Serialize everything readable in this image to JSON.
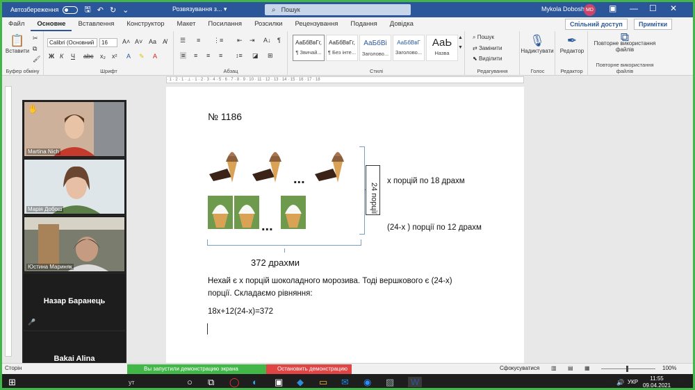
{
  "titlebar": {
    "autosave_label": "Автозбереження",
    "document_title": "Розвязування з... ▾",
    "search_placeholder": "Пошук",
    "user_name": "Mykola Dobosh",
    "user_initials": "MD"
  },
  "tabs": [
    "Файл",
    "Основне",
    "Вставлення",
    "Конструктор",
    "Макет",
    "Посилання",
    "Розсилки",
    "Рецензування",
    "Подання",
    "Довідка"
  ],
  "active_tab": "Основне",
  "share_label": "Спільний доступ",
  "notes_label": "Примітки",
  "ribbon": {
    "clipboard": {
      "paste": "Вставити",
      "label": "Буфер обміну"
    },
    "font": {
      "name": "Calibri (Основний",
      "size": "16",
      "label": "Шрифт"
    },
    "paragraph": {
      "label": "Абзац"
    },
    "styles": {
      "label": "Стилі",
      "items": [
        {
          "sample": "АаБбВвГг,",
          "name": "¶ Звичай..."
        },
        {
          "sample": "АаБбВвГг,",
          "name": "¶ Без інте..."
        },
        {
          "sample": "АаБбВі",
          "name": "Заголово..."
        },
        {
          "sample": "АаБбВвГ",
          "name": "Заголово..."
        },
        {
          "sample": "АаЬ",
          "name": "Назва"
        }
      ]
    },
    "editing": {
      "find": "Пошук",
      "replace": "Замінити",
      "select": "Виділити",
      "label": "Редагування"
    },
    "voice": {
      "dictate": "Надиктувати",
      "label": "Голос"
    },
    "editor": {
      "editor": "Редактор",
      "label": "Редактор"
    },
    "reuse": {
      "button": "Повторне використання файлів",
      "label": "Повторне використання файлів"
    }
  },
  "document": {
    "problem_number": "№ 1186",
    "vertical_label": "24 порції",
    "label_chocolate": "х порцій по 18 драхм",
    "label_cream": "(24-х ) порції по 12 драхм",
    "total_label": "372 драхми",
    "text_line1": "Нехай є х порцій шоколадного морозива. Тоді вершкового є (24-х)",
    "text_line2": "порції. Складаємо рівняння:",
    "equation": "18х+12(24-х)=372",
    "dots": "..."
  },
  "participants": [
    {
      "name": "Martina Nich",
      "type": "video"
    },
    {
      "name": "Марія Добош",
      "type": "video"
    },
    {
      "name": "Юстина Мариняк",
      "type": "video"
    },
    {
      "name": "Назар Баранець",
      "type": "name"
    },
    {
      "name": "Bakai Alina",
      "type": "name"
    }
  ],
  "status": {
    "screen_share": "Вы запустили демонстрацию экрана",
    "stop_share": "Остановить демонстрацию",
    "focus": "Сфокусуватися",
    "zoom": "100%",
    "left_fragment": "Сторін",
    "taskbar_fragment": "ут"
  },
  "taskbar": {
    "lang": "УКР",
    "time": "11:55",
    "date": "09.04.2021"
  }
}
